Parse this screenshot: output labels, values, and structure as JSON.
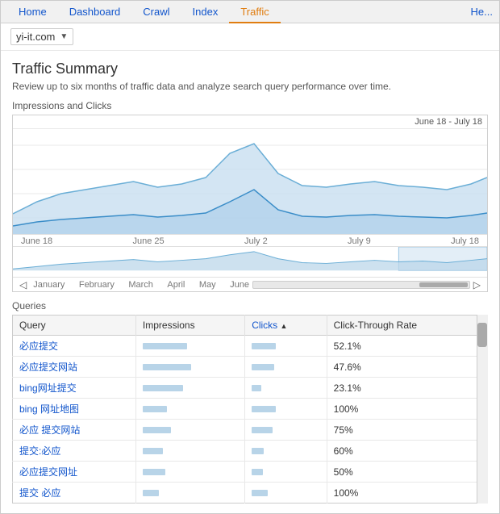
{
  "nav": {
    "items": [
      {
        "label": "Home",
        "active": false
      },
      {
        "label": "Dashboard",
        "active": false
      },
      {
        "label": "Crawl",
        "active": false
      },
      {
        "label": "Index",
        "active": false
      },
      {
        "label": "Traffic",
        "active": true
      }
    ],
    "help_label": "He..."
  },
  "toolbar": {
    "site": "yi-it.com",
    "arrow": "▼"
  },
  "main": {
    "title": "Traffic Summary",
    "description": "Review up to six months of traffic data and analyze search query performance over time.",
    "chart_section_label": "Impressions and Clicks",
    "chart_date_range": "June 18 - July 18",
    "chart_x_labels": [
      "June 18",
      "June 25",
      "July 2",
      "July 9",
      "July 18"
    ],
    "chart_nav_labels": [
      "January",
      "February",
      "March",
      "April",
      "May",
      "June"
    ],
    "queries_label": "Queries",
    "queries_table": {
      "headers": [
        {
          "label": "Query",
          "sortable": false
        },
        {
          "label": "Impressions",
          "sortable": false
        },
        {
          "label": "Clicks",
          "sortable": true,
          "sort_dir": "▲"
        },
        {
          "label": "Click-Through Rate",
          "sortable": false
        }
      ],
      "rows": [
        {
          "query": "必应提交",
          "impressions_w": 55,
          "clicks_w": 30,
          "ctr": "52.1%"
        },
        {
          "query": "必应提交网站",
          "impressions_w": 60,
          "clicks_w": 28,
          "ctr": "47.6%"
        },
        {
          "query": "bing网址提交",
          "impressions_w": 50,
          "clicks_w": 12,
          "ctr": "23.1%"
        },
        {
          "query": "bing 网址地图",
          "impressions_w": 30,
          "clicks_w": 30,
          "ctr": "100%"
        },
        {
          "query": "必应 提交网站",
          "impressions_w": 35,
          "clicks_w": 26,
          "ctr": "75%"
        },
        {
          "query": "提交:必应",
          "impressions_w": 25,
          "clicks_w": 15,
          "ctr": "60%"
        },
        {
          "query": "必应提交网址",
          "impressions_w": 28,
          "clicks_w": 14,
          "ctr": "50%"
        },
        {
          "query": "提交 必应",
          "impressions_w": 20,
          "clicks_w": 20,
          "ctr": "100%"
        }
      ]
    }
  }
}
